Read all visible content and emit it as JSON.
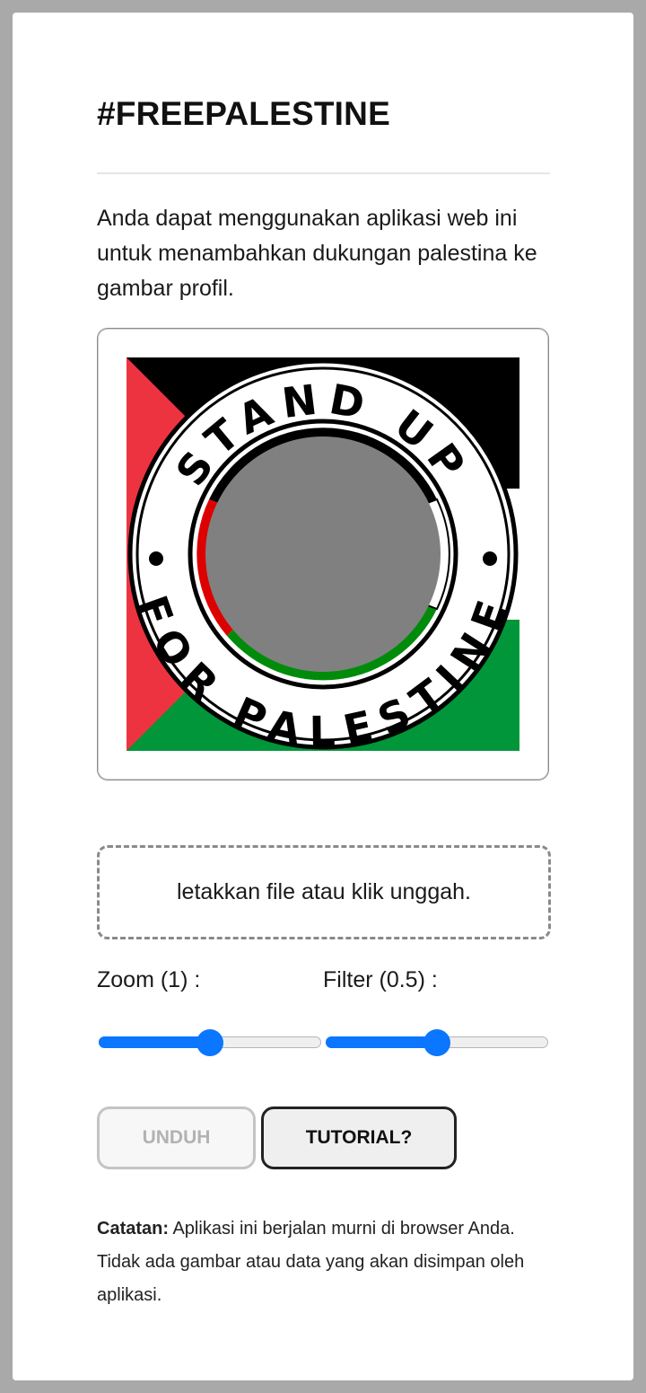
{
  "header": {
    "title": "#FREEPALESTINE"
  },
  "intro": {
    "text": "Anda dapat menggunakan aplikasi web ini untuk menambahkan dukungan palestina ke gambar profil."
  },
  "preview": {
    "frame_text_top": "STAND UP",
    "frame_text_bottom": "FOR PALESTINE",
    "colors": {
      "red": "#ee3340",
      "black": "#000000",
      "white": "#ffffff",
      "green": "#009639",
      "placeholder": "#808080"
    }
  },
  "dropzone": {
    "label": "letakkan file atau klik unggah."
  },
  "controls": {
    "zoom_label": "Zoom (1) :",
    "filter_label": "Filter (0.5) :",
    "zoom_value_fraction": 0.5,
    "filter_value_fraction": 0.5,
    "accent_color": "#0b76ff"
  },
  "buttons": {
    "download_label": "UNDUH",
    "tutorial_label": "TUTORIAL?"
  },
  "note": {
    "prefix": "Catatan:",
    "text": " Aplikasi ini berjalan murni di browser Anda. Tidak ada gambar atau data yang akan disimpan oleh aplikasi."
  }
}
